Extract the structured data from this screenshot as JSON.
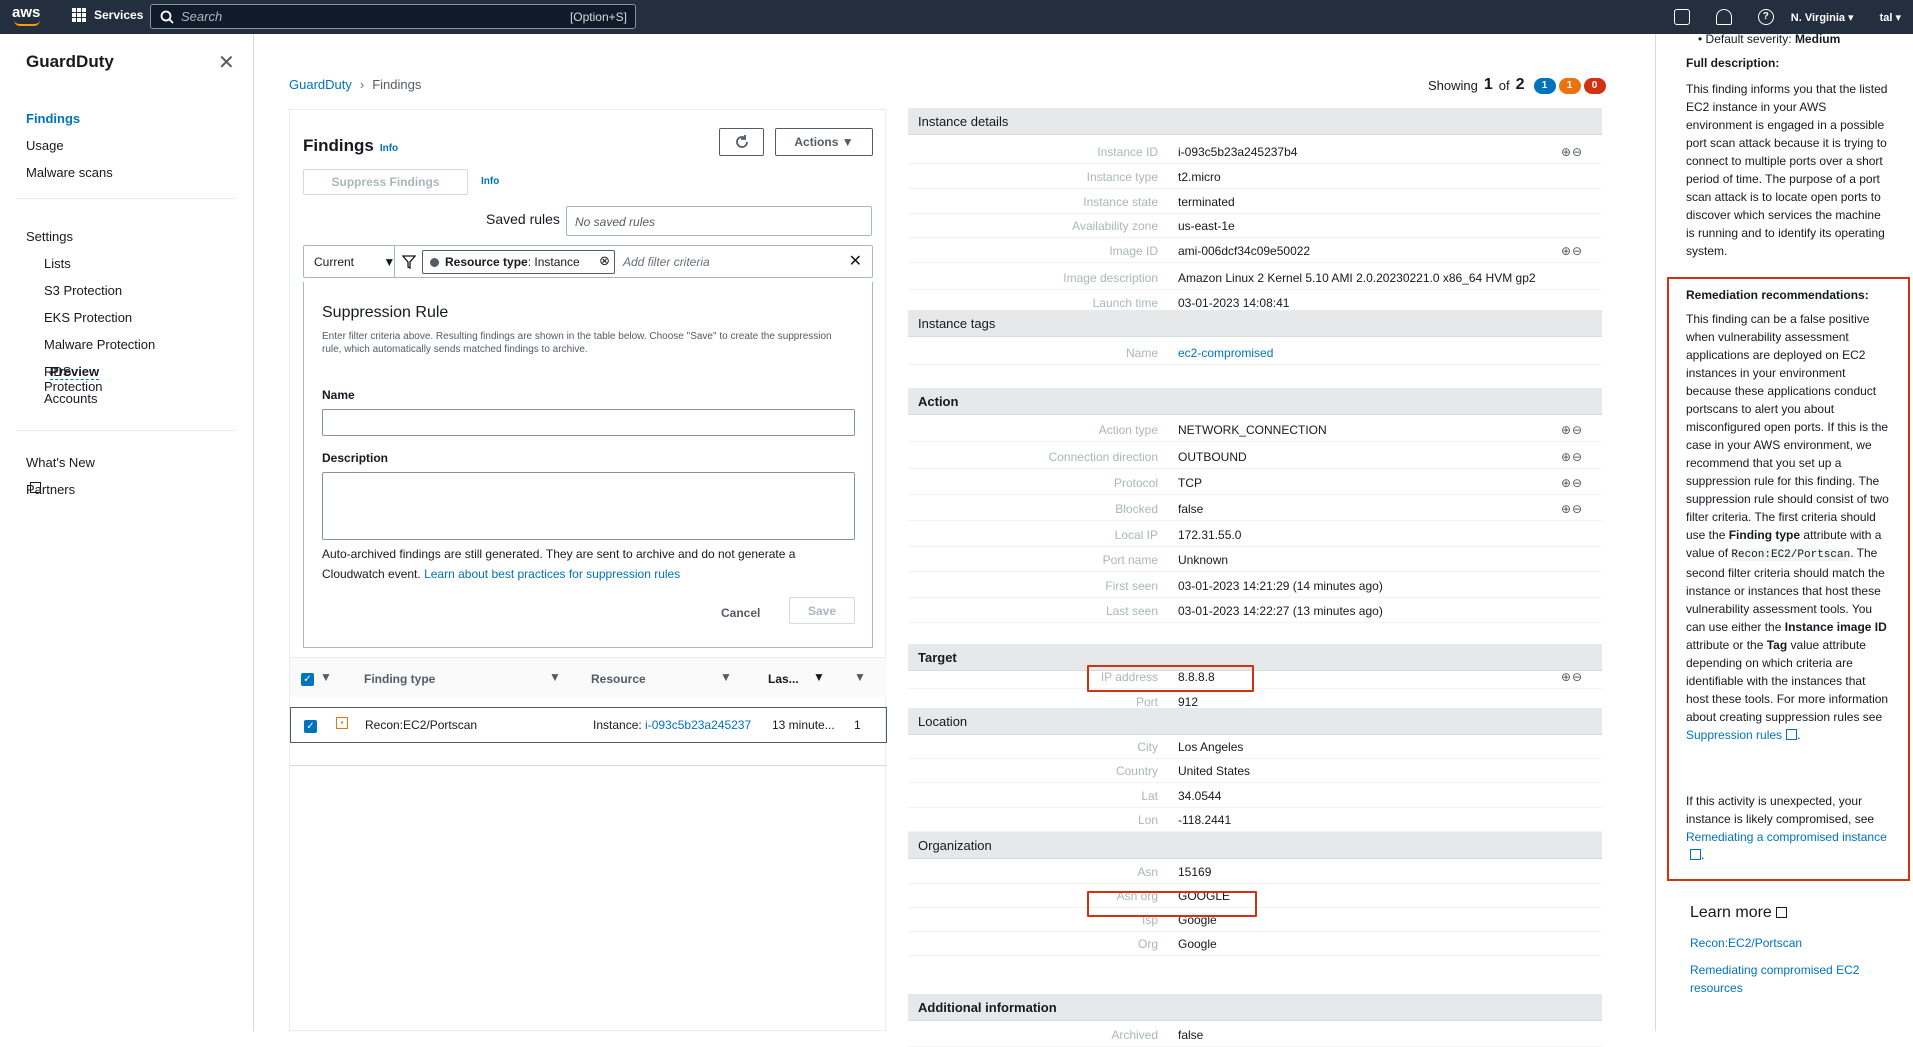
{
  "topbar": {
    "logo": "aws",
    "services": "Services",
    "search_placeholder": "Search",
    "search_shortcut": "[Option+S]",
    "region": "N. Virginia ▾",
    "user": "tal ▾"
  },
  "sidebar": {
    "title": "GuardDuty",
    "items": [
      {
        "label": "Findings"
      },
      {
        "label": "Usage"
      },
      {
        "label": "Malware scans"
      },
      {
        "label": "Settings"
      },
      {
        "label": "Lists"
      },
      {
        "label": "S3 Protection"
      },
      {
        "label": "EKS Protection"
      },
      {
        "label": "Malware Protection"
      },
      {
        "label": "RDS Protection"
      },
      {
        "label": "Accounts"
      },
      {
        "label": "What's New"
      },
      {
        "label": "Partners"
      }
    ],
    "preview": "Preview"
  },
  "breadcrumb": {
    "root": "GuardDuty",
    "current": "Findings"
  },
  "showing": {
    "label": "Showing",
    "current": "1",
    "of": "of",
    "total": "2",
    "badges": [
      {
        "count": "1",
        "color": "#0073bb"
      },
      {
        "count": "1",
        "color": "#ec7211"
      },
      {
        "count": "0",
        "color": "#d13212"
      }
    ]
  },
  "findings": {
    "title": "Findings",
    "info": "Info",
    "actions": "Actions ▼",
    "suppress": "Suppress Findings",
    "suppress_info": "Info",
    "saved_rules_label": "Saved rules",
    "saved_rules_value": "No saved rules",
    "filter_current": "Current",
    "filter_chip_key": "Resource type",
    "filter_chip_value": ": Instance",
    "filter_placeholder": "Add filter criteria"
  },
  "suppression": {
    "title": "Suppression Rule",
    "description": "Enter filter criteria above. Resulting findings are shown in the table below. Choose \"Save\" to create the suppression rule, which automatically sends matched findings to archive.",
    "name_label": "Name",
    "description_label": "Description",
    "note": "Auto-archived findings are still generated. They are sent to archive and do not generate a Cloudwatch event.",
    "note_link": "Learn about best practices for suppression rules",
    "cancel": "Cancel",
    "save": "Save"
  },
  "table": {
    "headers": [
      "Finding type",
      "Resource",
      "Las..."
    ],
    "rows": [
      {
        "finding_type": "Recon:EC2/Portscan",
        "resource_prefix": "Instance:",
        "resource_id": "i-093c5b23a245237",
        "last": "13 minute...",
        "count": "1"
      }
    ]
  },
  "details": {
    "instance_details": {
      "title": "Instance details",
      "rows": [
        {
          "key": "Instance ID",
          "value": "i-093c5b23a245237b4",
          "zoom": true
        },
        {
          "key": "Instance type",
          "value": "t2.micro",
          "zoom": false
        },
        {
          "key": "Instance state",
          "value": "terminated",
          "zoom": false
        },
        {
          "key": "Availability zone",
          "value": "us-east-1e",
          "zoom": false
        },
        {
          "key": "Image ID",
          "value": "ami-006dcf34c09e50022",
          "zoom": true
        },
        {
          "key": "Image description",
          "value": "Amazon Linux 2 Kernel 5.10 AMI 2.0.20230221.0 x86_64 HVM gp2",
          "zoom": false
        },
        {
          "key": "Launch time",
          "value": "03-01-2023 14:08:41",
          "zoom": false
        }
      ]
    },
    "instance_tags": {
      "title": "Instance tags",
      "rows": [
        {
          "key": "Name",
          "value": "ec2-compromised"
        }
      ]
    },
    "action": {
      "title": "Action",
      "rows": [
        {
          "key": "Action type",
          "value": "NETWORK_CONNECTION",
          "zoom": true
        },
        {
          "key": "Connection direction",
          "value": "OUTBOUND",
          "zoom": true
        },
        {
          "key": "Protocol",
          "value": "TCP",
          "zoom": true
        },
        {
          "key": "Blocked",
          "value": "false",
          "zoom": true
        },
        {
          "key": "Local IP",
          "value": "172.31.55.0",
          "zoom": false
        },
        {
          "key": "Port name",
          "value": "Unknown",
          "zoom": false
        },
        {
          "key": "First seen",
          "value": "03-01-2023 14:21:29 (14 minutes ago)",
          "zoom": false
        },
        {
          "key": "Last seen",
          "value": "03-01-2023 14:22:27 (13 minutes ago)",
          "zoom": false
        }
      ]
    },
    "target": {
      "title": "Target",
      "rows": [
        {
          "key": "IP address",
          "value": "8.8.8.8",
          "zoom": true
        },
        {
          "key": "Port",
          "value": "912",
          "zoom": false
        }
      ]
    },
    "location": {
      "title": "Location",
      "rows": [
        {
          "key": "City",
          "value": "Los Angeles"
        },
        {
          "key": "Country",
          "value": "United States"
        },
        {
          "key": "Lat",
          "value": "34.0544"
        },
        {
          "key": "Lon",
          "value": "-118.2441"
        }
      ]
    },
    "organization": {
      "title": "Organization",
      "rows": [
        {
          "key": "Asn",
          "value": "15169"
        },
        {
          "key": "Asn org",
          "value": "GOOGLE"
        },
        {
          "key": "Isp",
          "value": "Google"
        },
        {
          "key": "Org",
          "value": "Google"
        }
      ]
    },
    "additional": {
      "title": "Additional information",
      "rows": [
        {
          "key": "Archived",
          "value": "false"
        }
      ]
    }
  },
  "right_panel": {
    "default_severity_label": "Default severity:",
    "default_severity_value": "Medium",
    "full_description_title": "Full description:",
    "full_description": "This finding informs you that the listed EC2 instance in your AWS environment is engaged in a possible port scan attack because it is trying to connect to multiple ports over a short period of time. The purpose of a port scan attack is to locate open ports to discover which services the machine is running and to identify its operating system.",
    "remediation_title": "Remediation recommendations:",
    "remediation_1": "This finding can be a false positive when vulnerability assessment applications are deployed on EC2 instances in your environment because these applications conduct portscans to alert you about misconfigured open ports. If this is the case in your AWS environment, we recommend that you set up a suppression rule for this finding. The suppression rule should consist of two filter criteria. The first criteria should use the",
    "remediation_b1": "Finding type",
    "remediation_2": "attribute with a value of",
    "remediation_code": "Recon:EC2/Portscan",
    "remediation_3": ". The second filter criteria should match the instance or instances that host these vulnerability assessment tools. You can use either the",
    "remediation_b2": "Instance image ID",
    "remediation_4": "attribute or the",
    "remediation_b3": "Tag",
    "remediation_5": "value attribute depending on which criteria are identifiable with the instances that host these tools. For more information about creating suppression rules see",
    "remediation_link": "Suppression rules",
    "unexpected": "If this activity is unexpected, your instance is likely compromised, see",
    "unexpected_link": "Remediating a compromised instance",
    "learn_more": "Learn more",
    "learn_links": [
      "Recon:EC2/Portscan",
      "Remediating compromised EC2 resources"
    ]
  }
}
